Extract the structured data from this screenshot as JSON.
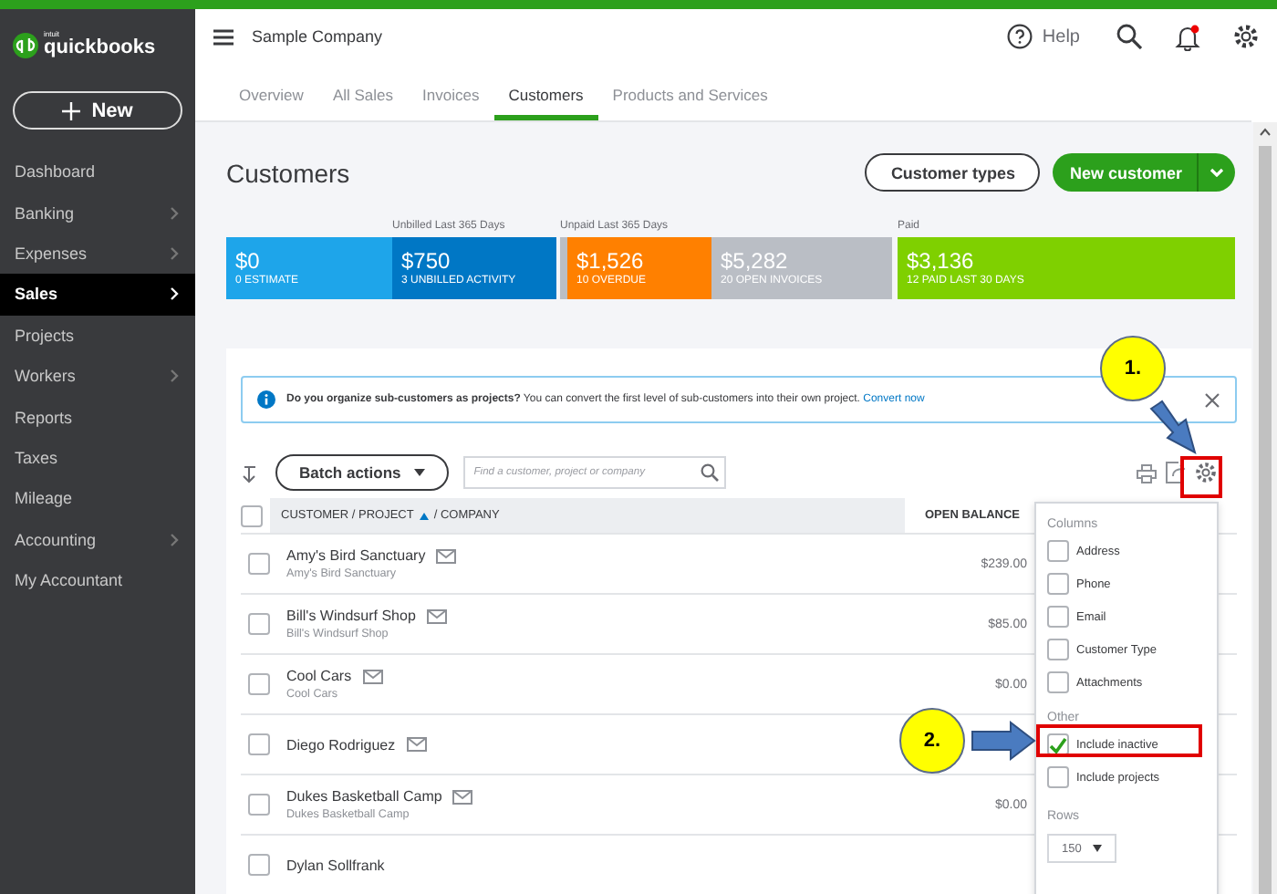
{
  "brand": {
    "prefix": "intuit",
    "name": "quickbooks"
  },
  "new_button": "New",
  "sidebar": [
    {
      "label": "Dashboard",
      "submenu": false,
      "selected": false
    },
    {
      "label": "Banking",
      "submenu": true,
      "selected": false
    },
    {
      "label": "Expenses",
      "submenu": true,
      "selected": false
    },
    {
      "label": "Sales",
      "submenu": true,
      "selected": true
    },
    {
      "label": "Projects",
      "submenu": false,
      "selected": false
    },
    {
      "label": "Workers",
      "submenu": true,
      "selected": false
    },
    {
      "label": "Reports",
      "submenu": false,
      "selected": false
    },
    {
      "label": "Taxes",
      "submenu": false,
      "selected": false
    },
    {
      "label": "Mileage",
      "submenu": false,
      "selected": false
    },
    {
      "label": "Accounting",
      "submenu": true,
      "selected": false
    },
    {
      "label": "My Accountant",
      "submenu": false,
      "selected": false
    }
  ],
  "header": {
    "company": "Sample Company",
    "help": "Help",
    "unread_notifications": true
  },
  "tabs": [
    {
      "label": "Overview",
      "selected": false
    },
    {
      "label": "All Sales",
      "selected": false
    },
    {
      "label": "Invoices",
      "selected": false
    },
    {
      "label": "Customers",
      "selected": true
    },
    {
      "label": "Products and Services",
      "selected": false
    }
  ],
  "page": {
    "title": "Customers",
    "secondary_button": "Customer types",
    "primary_button": "New customer"
  },
  "money_bar": {
    "segments": [
      {
        "amount": "$0",
        "label": "0 ESTIMATE",
        "color": "#1ea5ea"
      },
      {
        "amount": "$750",
        "label": "3 UNBILLED ACTIVITY",
        "color": "#0077c5",
        "caption": "Unbilled Last 365 Days"
      },
      {
        "kind": "gap"
      },
      {
        "kind": "stripe",
        "color": "#babec5",
        "caption": "Unpaid Last 365 Days"
      },
      {
        "amount": "$1,526",
        "label": "10 OVERDUE",
        "color": "#ff8000"
      },
      {
        "amount": "$5,282",
        "label": "20 OPEN INVOICES",
        "color": "#babec5"
      },
      {
        "kind": "gap"
      },
      {
        "amount": "$3,136",
        "label": "12 PAID LAST 30 DAYS",
        "color": "#7fd000",
        "caption": "Paid"
      }
    ]
  },
  "banner": {
    "text": "**Do you organize sub-customers as projects?** You can convert the first level of sub-customers into their own project.",
    "link": "Convert now"
  },
  "toolbar": {
    "batch": "Batch actions",
    "search_placeholder": "Find a customer, project or company"
  },
  "table": {
    "all_selected": false,
    "columns": [
      {
        "label": "CUSTOMER / PROJECT",
        "sorted": true
      },
      {
        "label": "/ COMPANY"
      },
      {
        "label": "OPEN BALANCE"
      }
    ],
    "rows": [
      {
        "name": "Amy's Bird Sanctuary",
        "company": "Amy's Bird Sanctuary",
        "balance": "$239.00",
        "selected": false
      },
      {
        "name": "Bill's Windsurf Shop",
        "company": "Bill's Windsurf Shop",
        "balance": "$85.00",
        "selected": false
      },
      {
        "name": "Cool Cars",
        "company": "Cool Cars",
        "balance": "$0.00",
        "selected": false
      },
      {
        "name": "Diego Rodriguez",
        "selected": false
      },
      {
        "name": "Dukes Basketball Camp",
        "company": "Dukes Basketball Camp",
        "balance": "$0.00",
        "selected": false
      },
      {
        "name": "Dylan Sollfrank",
        "selected": false
      }
    ]
  },
  "settings_menu": {
    "columns_heading": "Columns",
    "columns": [
      {
        "label": "Address",
        "checked": false
      },
      {
        "label": "Phone",
        "checked": false
      },
      {
        "label": "Email",
        "checked": false
      },
      {
        "label": "Customer Type",
        "checked": false
      },
      {
        "label": "Attachments",
        "checked": false
      }
    ],
    "other_heading": "Other",
    "other": [
      {
        "label": "Include inactive",
        "checked": true
      },
      {
        "label": "Include projects",
        "checked": false
      }
    ],
    "rows_heading": "Rows",
    "rows_value": "150"
  },
  "callouts": [
    {
      "label": "1."
    },
    {
      "label": "2."
    }
  ]
}
